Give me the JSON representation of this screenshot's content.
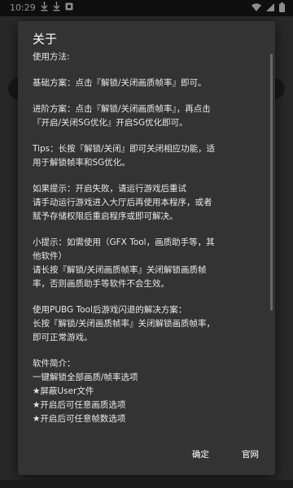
{
  "status_bar": {
    "time": "10:29",
    "notification_icons": [
      "download-icon",
      "download-icon",
      "app-notification-icon"
    ],
    "system_icons": [
      "wifi-icon",
      "signal-icon",
      "battery-icon"
    ]
  },
  "dialog": {
    "title": "关于",
    "paragraphs": [
      [
        "使用方法:"
      ],
      [
        "基础方案：点击『解锁/关闭画质帧率』即可。"
      ],
      [
        "进阶方案：点击『解锁/关闭画质帧率』，再点击",
        "『开启/关闭SG优化』开启SG优化即可。"
      ],
      [
        "Tips：长按『解锁/关闭』即可关闭相应功能，适",
        "用于解锁帧率和SG优化。"
      ],
      [
        "如果提示：开启失败，请运行游戏后重试",
        "请手动运行游戏进入大厅后再使用本程序，或者",
        "赋予存储权限后重启程序或即可解决。"
      ],
      [
        "小提示：如需使用（GFX Tool，画质助手等，其",
        "他软件）",
        "请长按『解锁/关闭画质帧率』关闭解锁画质帧",
        "率，否则画质助手等软件不会生效。"
      ],
      [
        "使用PUBG Tool后游戏闪退的解决方案：",
        "长按『解锁/关闭画质帧率』关闭解锁画质帧率，",
        "即可正常游戏。"
      ],
      [
        "软件简介：",
        "一键解锁全部画质/帧率选项",
        "★屏蔽User文件",
        "★开启后可任意画质选项",
        "★开启后可任意帧数选项"
      ]
    ],
    "confirm_label": "确定",
    "website_label": "官网"
  }
}
